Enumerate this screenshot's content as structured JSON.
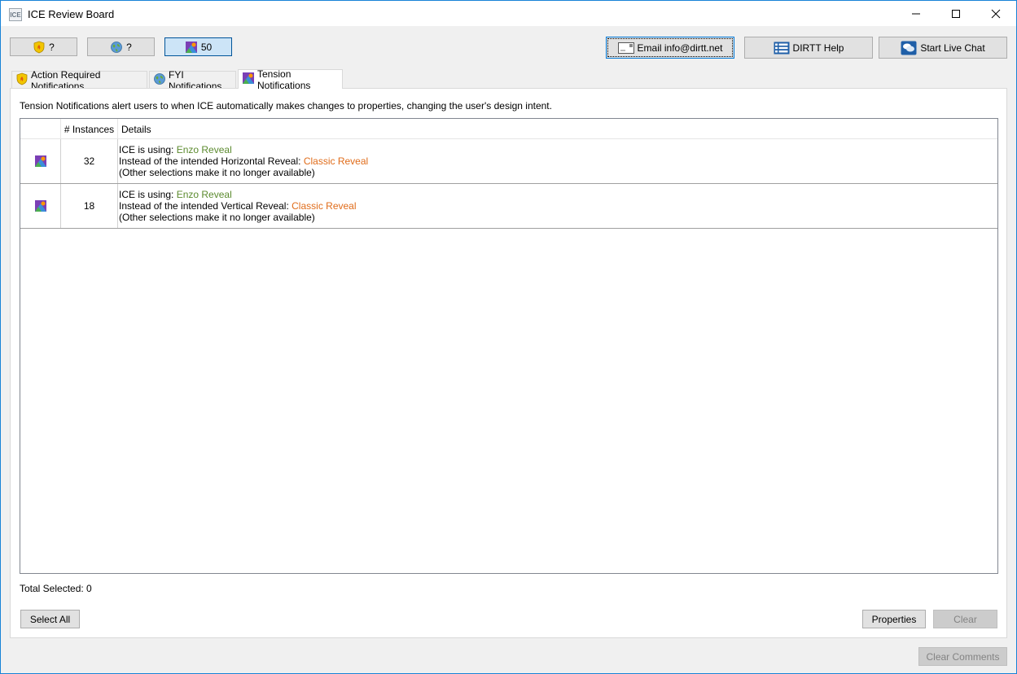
{
  "window": {
    "title": "ICE Review Board",
    "app_icon_text": "ICE"
  },
  "toolbar": {
    "action_count": "?",
    "fyi_count": "?",
    "tension_count": "50",
    "email_label": "Email info@dirtt.net",
    "help_label": "DIRTT Help",
    "chat_label": "Start Live Chat"
  },
  "tabs": [
    {
      "label": "Action Required Notifications"
    },
    {
      "label": "FYI Notifications"
    },
    {
      "label": "Tension Notifications"
    }
  ],
  "panel": {
    "description": "Tension Notifications alert users to when ICE automatically makes changes to properties, changing the user's design intent.",
    "columns": [
      "",
      "# Instances",
      "Details"
    ],
    "rows": [
      {
        "instances": "32",
        "using_prefix": "ICE is using: ",
        "using_value": "Enzo Reveal",
        "instead_prefix": "Instead of the intended Horizontal Reveal: ",
        "instead_value": "Classic Reveal",
        "note": "(Other selections make it no longer available)"
      },
      {
        "instances": "18",
        "using_prefix": "ICE is using: ",
        "using_value": "Enzo Reveal",
        "instead_prefix": "Instead of the intended Vertical Reveal: ",
        "instead_value": "Classic Reveal",
        "note": "(Other selections make it no longer available)"
      }
    ],
    "total_selected": "Total Selected: 0",
    "select_all_label": "Select All",
    "properties_label": "Properties",
    "clear_label": "Clear"
  },
  "footer": {
    "clear_comments_label": "Clear Comments"
  },
  "colors": {
    "accent_border": "#1883d7",
    "using_value": "#5b8a2e",
    "instead_value": "#e06c1a"
  }
}
